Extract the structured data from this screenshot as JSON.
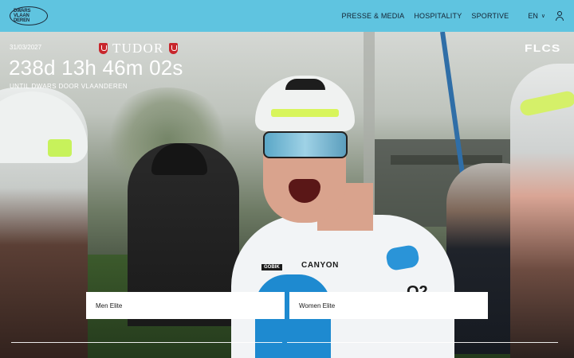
{
  "header": {
    "logo_lines": [
      "DWARS",
      "VLAAN",
      "DEREN"
    ],
    "nav": [
      "PRESSE & MEDIA",
      "HOSPITALITY",
      "SPORTIVE"
    ],
    "language": "EN",
    "colors": {
      "bar": "#5fc4e0",
      "text": "#132232"
    }
  },
  "hero": {
    "date": "31/03/2027",
    "countdown": "238d 13h 46m 02s",
    "until": "UNTIL DWARS DOOR VLAANDEREN",
    "sponsor_main": "TUDOR",
    "sponsor_right": "FLCS",
    "jersey_text": {
      "canyon": "CANYON",
      "gobik": "GOBIK",
      "oz": "O2"
    }
  },
  "categories": [
    {
      "label": "Men Elite"
    },
    {
      "label": "Women Elite"
    }
  ]
}
